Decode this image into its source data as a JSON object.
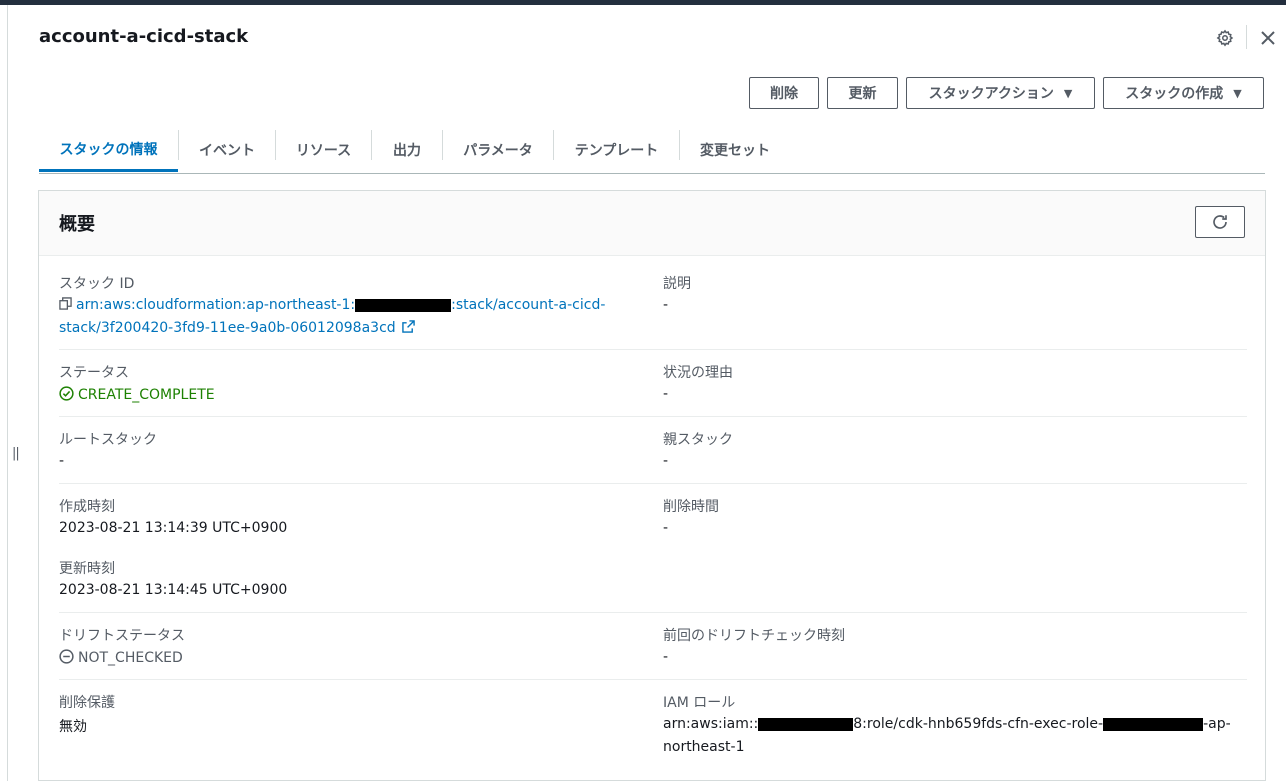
{
  "header": {
    "title": "account-a-cicd-stack",
    "settings_icon": "gear-icon",
    "close_icon": "close-icon"
  },
  "actions": {
    "delete_label": "削除",
    "update_label": "更新",
    "stack_actions_label": "スタックアクション",
    "create_stack_label": "スタックの作成"
  },
  "tabs": [
    {
      "label": "スタックの情報",
      "active": true
    },
    {
      "label": "イベント"
    },
    {
      "label": "リソース"
    },
    {
      "label": "出力"
    },
    {
      "label": "パラメータ"
    },
    {
      "label": "テンプレート"
    },
    {
      "label": "変更セット"
    }
  ],
  "overview": {
    "title": "概要",
    "stack_id": {
      "label": "スタック ID",
      "line1_prefix": "arn:aws:cloudformation:ap-northeast-1:",
      "line1_suffix": ":stack/account-a-cicd-",
      "line2": "stack/3f200420-3fd9-11ee-9a0b-06012098a3cd"
    },
    "description": {
      "label": "説明",
      "value": "-"
    },
    "status": {
      "label": "ステータス",
      "value": "CREATE_COMPLETE"
    },
    "status_reason": {
      "label": "状況の理由",
      "value": "-"
    },
    "root_stack": {
      "label": "ルートスタック",
      "value": "-"
    },
    "parent_stack": {
      "label": "親スタック",
      "value": "-"
    },
    "created_time": {
      "label": "作成時刻",
      "value": "2023-08-21 13:14:39 UTC+0900"
    },
    "deleted_time": {
      "label": "削除時間",
      "value": "-"
    },
    "updated_time": {
      "label": "更新時刻",
      "value": "2023-08-21 13:14:45 UTC+0900"
    },
    "drift_status": {
      "label": "ドリフトステータス",
      "value": "NOT_CHECKED"
    },
    "last_drift_check": {
      "label": "前回のドリフトチェック時刻",
      "value": "-"
    },
    "termination_protection": {
      "label": "削除保護",
      "value": "無効"
    },
    "iam_role": {
      "label": "IAM ロール",
      "part1": "arn:aws:iam::",
      "part2": "8:role/cdk-hnb659fds-cfn-exec-role-",
      "part3": "-ap-",
      "line2": "northeast-1"
    }
  },
  "colors": {
    "link": "#0073bb",
    "success": "#1d8102",
    "border": "#d5dbdb",
    "text": "#16191f",
    "muted": "#545b64"
  }
}
